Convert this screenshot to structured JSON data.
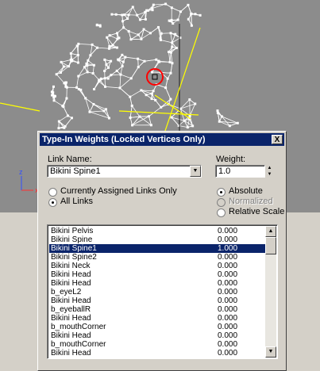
{
  "dialog": {
    "title": "Type-In Weights (Locked Vertices Only)",
    "close_label": "X",
    "link_name_label": "Link Name:",
    "link_name_value": "Bikini Spine1",
    "weight_label": "Weight:",
    "weight_value": "1.0",
    "filter_options": [
      {
        "label": "Currently Assigned Links Only",
        "selected": false
      },
      {
        "label": "All Links",
        "selected": true
      }
    ],
    "mode_options": [
      {
        "label": "Absolute",
        "selected": true,
        "enabled": true
      },
      {
        "label": "Normalized",
        "selected": false,
        "enabled": false
      },
      {
        "label": "Relative Scale",
        "selected": false,
        "enabled": true
      }
    ],
    "list": [
      {
        "name": "Bikini Pelvis",
        "value": "0.000"
      },
      {
        "name": "Bikini Spine",
        "value": "0.000"
      },
      {
        "name": "Bikini Spine1",
        "value": "1.000",
        "selected": true
      },
      {
        "name": "Bikini Spine2",
        "value": "0.000"
      },
      {
        "name": "Bikini Neck",
        "value": "0.000"
      },
      {
        "name": "Bikini Head",
        "value": "0.000"
      },
      {
        "name": "Bikini Head",
        "value": "0.000"
      },
      {
        "name": "b_eyeL2",
        "value": "0.000"
      },
      {
        "name": "Bikini Head",
        "value": "0.000"
      },
      {
        "name": "b_eyeballR",
        "value": "0.000"
      },
      {
        "name": "Bikini Head",
        "value": "0.000"
      },
      {
        "name": "b_mouthCorner",
        "value": "0.000"
      },
      {
        "name": "Bikini Head",
        "value": "0.000"
      },
      {
        "name": "b_mouthCorner",
        "value": "0.000"
      },
      {
        "name": "Bikini Head",
        "value": "0.000"
      }
    ]
  },
  "viewport": {
    "axis_z_label": "z",
    "axis_x_label": "x"
  },
  "colors": {
    "titlebar": "#0a246a",
    "selection": "#0a246a",
    "mesh": "#ffffff",
    "highlight_ring": "#ff0000",
    "gizmo": "#ffff00",
    "viewport_bg": "#8c8c8c"
  }
}
